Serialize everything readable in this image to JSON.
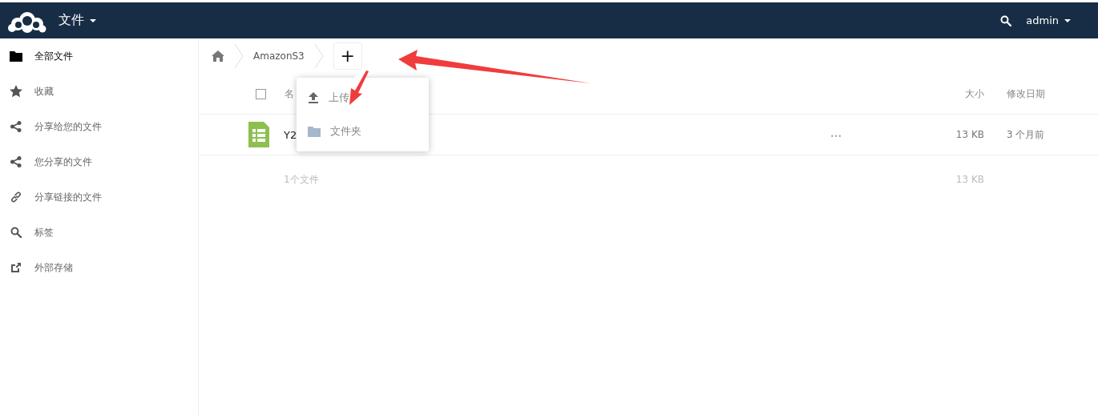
{
  "header": {
    "app_menu": "文件",
    "user": "admin"
  },
  "sidebar": {
    "items": [
      {
        "label": "全部文件",
        "kind": "folder",
        "selected": true
      },
      {
        "label": "收藏",
        "kind": "star",
        "selected": false
      },
      {
        "label": "分享给您的文件",
        "kind": "share",
        "selected": false
      },
      {
        "label": "您分享的文件",
        "kind": "share",
        "selected": false
      },
      {
        "label": "分享链接的文件",
        "kind": "link",
        "selected": false
      },
      {
        "label": "标签",
        "kind": "search",
        "selected": false
      },
      {
        "label": "外部存储",
        "kind": "external",
        "selected": false
      }
    ]
  },
  "breadcrumb": {
    "items": [
      "AmazonS3"
    ],
    "new_button": "+"
  },
  "new_menu": {
    "items": [
      {
        "label": "上传",
        "kind": "upload"
      },
      {
        "label": "文件夹",
        "kind": "folder"
      }
    ]
  },
  "table": {
    "select_all": {
      "checked": false
    },
    "columns": [
      "名",
      "大小",
      "修改日期"
    ],
    "rows": [
      {
        "name": "Y2",
        "actions": "•••",
        "size": "13 KB",
        "modified": "3 个月前"
      }
    ],
    "summary": {
      "count": "1个文件",
      "size": "13 KB"
    }
  }
}
